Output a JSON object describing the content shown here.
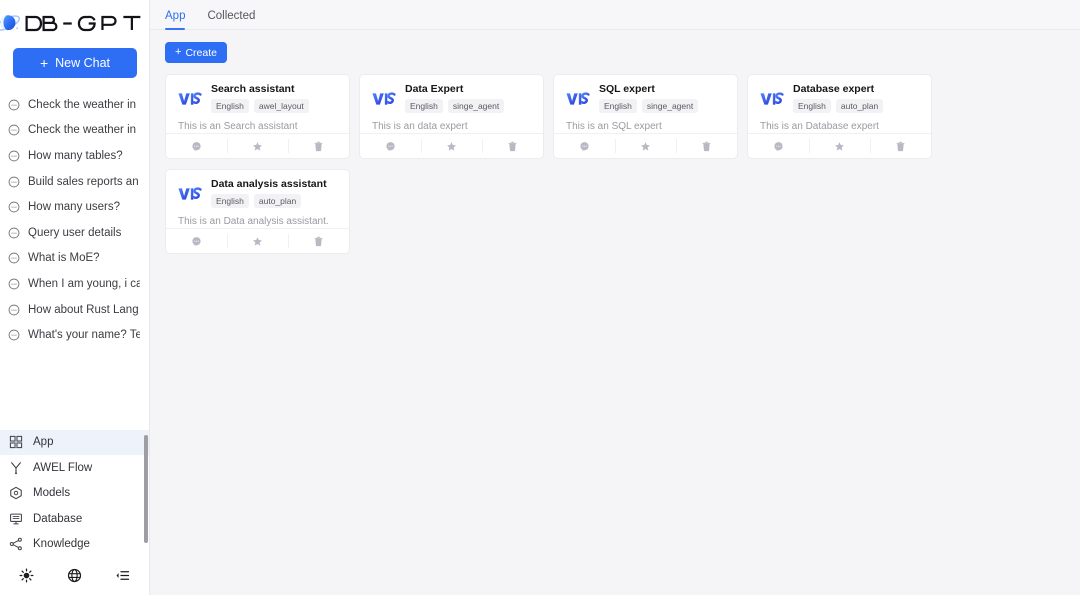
{
  "brand": {
    "name": "DB-GPT",
    "accent": "#2d6ef5"
  },
  "sidebar": {
    "new_chat_label": "New Chat",
    "chats": [
      {
        "label": "Check the weather in",
        "icon": "chat-bubble-icon"
      },
      {
        "label": "Check the weather in",
        "icon": "chat-bubble-icon"
      },
      {
        "label": "How many tables?",
        "icon": "chat-bubble-icon"
      },
      {
        "label": "Build sales reports an",
        "icon": "chat-bubble-icon"
      },
      {
        "label": "How many users?",
        "icon": "chat-bubble-icon"
      },
      {
        "label": "Query user details",
        "icon": "chat-bubble-icon"
      },
      {
        "label": "What is MoE?",
        "icon": "chat-bubble-icon"
      },
      {
        "label": "When I am young, i ca",
        "icon": "chat-bubble-icon"
      },
      {
        "label": "How about Rust Lang",
        "icon": "chat-bubble-icon"
      },
      {
        "label": "What's your name? Te",
        "icon": "chat-bubble-icon"
      }
    ],
    "nav": [
      {
        "label": "App",
        "icon": "grid-icon",
        "active": true
      },
      {
        "label": "AWEL Flow",
        "icon": "flow-branch-icon",
        "active": false
      },
      {
        "label": "Models",
        "icon": "model-globe-icon",
        "active": false
      },
      {
        "label": "Database",
        "icon": "database-monitor-icon",
        "active": false
      },
      {
        "label": "Knowledge",
        "icon": "knowledge-share-icon",
        "active": false
      }
    ],
    "bottom_buttons": [
      {
        "icon": "sun-theme-icon",
        "name": "theme-toggle-button"
      },
      {
        "icon": "globe-language-icon",
        "name": "language-button"
      },
      {
        "icon": "collapse-sidebar-icon",
        "name": "collapse-sidebar-button"
      }
    ]
  },
  "main": {
    "tabs": [
      {
        "label": "App",
        "active": true
      },
      {
        "label": "Collected",
        "active": false
      }
    ],
    "create_label": "Create",
    "cards": [
      {
        "title": "Search assistant",
        "tags": [
          "English",
          "awel_layout"
        ],
        "description": "This is an Search assistant",
        "logo": "vis-logo-icon",
        "actions": [
          "chat-bubble-icon",
          "star-icon",
          "trash-icon"
        ]
      },
      {
        "title": "Data Expert",
        "tags": [
          "English",
          "singe_agent"
        ],
        "description": "This is an data expert",
        "logo": "vis-logo-icon",
        "actions": [
          "chat-bubble-icon",
          "star-icon",
          "trash-icon"
        ]
      },
      {
        "title": "SQL expert",
        "tags": [
          "English",
          "singe_agent"
        ],
        "description": "This is an SQL expert",
        "logo": "vis-logo-icon",
        "actions": [
          "chat-bubble-icon",
          "star-icon",
          "trash-icon"
        ]
      },
      {
        "title": "Database expert",
        "tags": [
          "English",
          "auto_plan"
        ],
        "description": "This is an Database expert",
        "logo": "vis-logo-icon",
        "actions": [
          "chat-bubble-icon",
          "star-icon",
          "trash-icon"
        ]
      },
      {
        "title": "Data analysis assistant",
        "tags": [
          "English",
          "auto_plan"
        ],
        "description": "This is an Data analysis assistant.",
        "logo": "vis-logo-icon",
        "actions": [
          "chat-bubble-icon",
          "star-icon",
          "trash-icon"
        ]
      }
    ]
  }
}
